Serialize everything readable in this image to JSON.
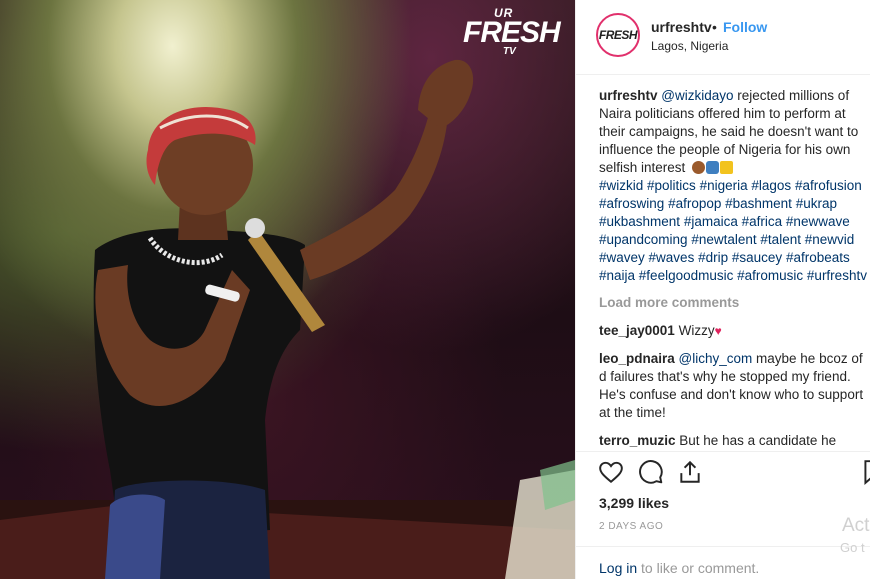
{
  "photo": {
    "watermark": {
      "ur": "UR",
      "fresh": "FRESH",
      "tv": "TV"
    }
  },
  "header": {
    "avatar_text": "FRESH",
    "username": "urfreshtv",
    "separator": "•",
    "follow_label": "Follow",
    "location": "Lagos, Nigeria"
  },
  "caption": {
    "username": "urfreshtv",
    "mention": "@wizkidayo",
    "text": " rejected millions of Naira politicians offered him to perform at their campaigns, he said he doesn't want to influence the people of Nigeria for his own selfish interest ",
    "hashtags": [
      "#wizkid",
      "#politics",
      "#nigeria",
      "#lagos",
      "#afrofusion",
      "#afroswing",
      "#afropop",
      "#bashment",
      "#ukrap",
      "#ukbashment",
      "#jamaica",
      "#africa",
      "#newwave",
      "#upandcoming",
      "#newtalent",
      "#talent",
      "#newvid",
      "#wavey",
      "#waves",
      "#drip",
      "#saucey",
      "#afrobeats",
      "#naija",
      "#feelgoodmusic",
      "#afromusic",
      "#urfreshtv"
    ]
  },
  "load_more": "Load more comments",
  "comments": [
    {
      "user": "tee_jay0001",
      "mention": "",
      "text": " Wizzy"
    },
    {
      "user": "leo_pdnaira",
      "mention": "@lichy_com",
      "text": " maybe he bcoz of d failures that's why he stopped my friend. He's confuse and don't know who to support at the time!"
    },
    {
      "user": "terro_muzic",
      "mention": "",
      "text": " But he has a candidate he"
    }
  ],
  "icons": [
    "heart-icon",
    "comment-icon",
    "share-icon",
    "bookmark-icon"
  ],
  "likes": "3,299 likes",
  "time_ago": "2 DAYS AGO",
  "login": {
    "link": "Log in",
    "rest": " to like or comment."
  },
  "os_overlay": {
    "activate": "Acti",
    "goto": "Go t"
  },
  "colors": {
    "link": "#003569",
    "follow": "#3897f0",
    "muted": "#999999",
    "text": "#262626"
  }
}
